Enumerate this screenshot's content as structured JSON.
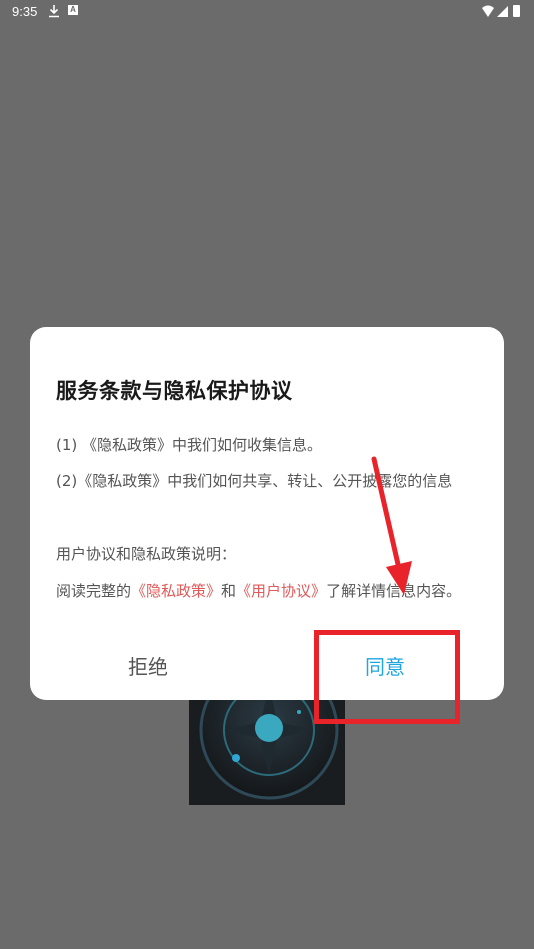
{
  "status_bar": {
    "time": "9:35",
    "a_badge": "A"
  },
  "dialog": {
    "title": "服务条款与隐私保护协议",
    "item1": "(1) 《隐私政策》中我们如何收集信息。",
    "item2": "(2)《隐私政策》中我们如何共享、转让、公开披露您的信息",
    "section_heading": "用户协议和隐私政策说明：",
    "read_prefix": "阅读完整的",
    "privacy_link": "《隐私政策》",
    "and_text": "和",
    "user_agreement_link": "《用户协议》",
    "read_suffix": "了解详情信息内容。",
    "refuse_button": "拒绝",
    "agree_button": "同意"
  },
  "colors": {
    "overlay": "#6b6b6b",
    "link": "#e05a5a",
    "agree": "#1ea6e0",
    "annotation": "#e8232a"
  }
}
